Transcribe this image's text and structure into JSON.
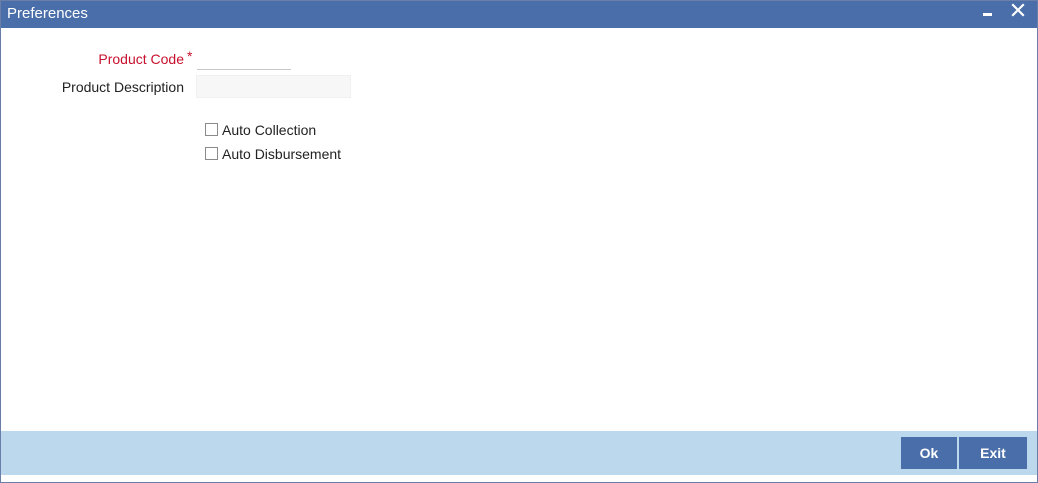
{
  "window": {
    "title": "Preferences",
    "minimize_icon": "minimize-icon",
    "close_icon": "close-icon"
  },
  "form": {
    "product_code": {
      "label": "Product Code",
      "required_marker": "*",
      "value": ""
    },
    "product_description": {
      "label": "Product Description",
      "value": ""
    },
    "checkboxes": [
      {
        "label": "Auto Collection",
        "checked": false
      },
      {
        "label": "Auto Disbursement",
        "checked": false
      }
    ]
  },
  "footer": {
    "ok_label": "Ok",
    "exit_label": "Exit"
  },
  "colors": {
    "titlebar": "#4a6ea9",
    "footer": "#bcd8ec",
    "required": "#c8102e",
    "button": "#4a6ea9"
  }
}
